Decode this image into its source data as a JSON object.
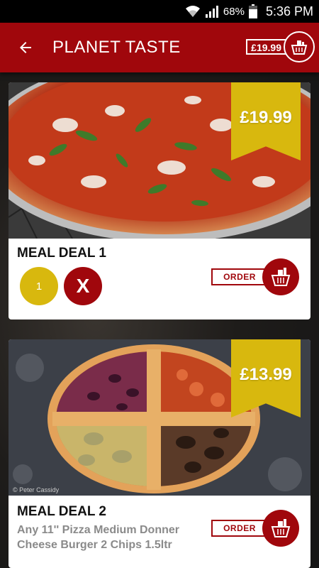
{
  "status_bar": {
    "battery": "68%",
    "time": "5:36 PM"
  },
  "header": {
    "title": "PLANET TASTE",
    "cart_total": "£19.99"
  },
  "deals": [
    {
      "title": "MEAL DEAL 1",
      "price": "£19.99",
      "quantity": "1",
      "remove_label": "X",
      "order_label": "ORDER"
    },
    {
      "title": "MEAL DEAL 2",
      "price": "£13.99",
      "description": "Any 11'' Pizza Medium Donner Cheese Burger 2 Chips 1.5ltr",
      "order_label": "ORDER",
      "photo_credit": "© Peter Cassidy"
    }
  ],
  "colors": {
    "primary": "#a0070c",
    "accent": "#d8b80e"
  }
}
